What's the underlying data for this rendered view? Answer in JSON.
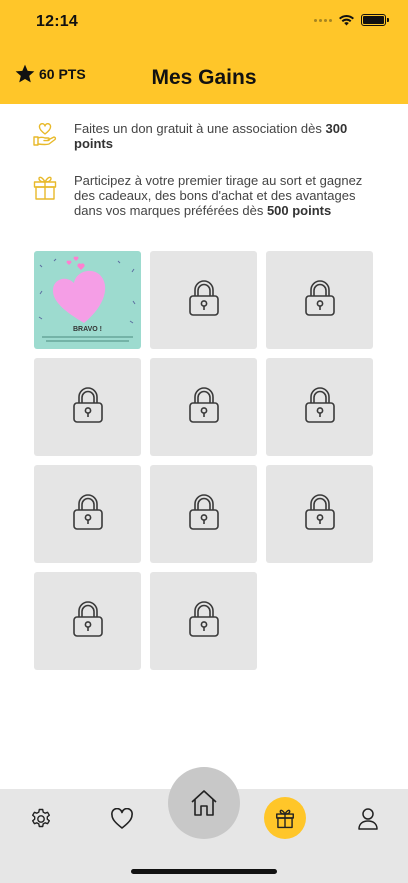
{
  "status_bar": {
    "time": "12:14"
  },
  "header": {
    "points": "60 PTS",
    "title": "Mes Gains"
  },
  "info": [
    {
      "text": "Faites un don gratuit à une association dès ",
      "bold": "300 points",
      "icon": "hand-heart-icon"
    },
    {
      "text": "Participez à votre premier tirage au sort et gagnez des cadeaux, des bons d'achat et des avantages dans vos marques préférées dès ",
      "bold": "500 points",
      "icon": "gift-icon"
    }
  ],
  "rewards": {
    "unlocked_label": "BRAVO !",
    "tiles": [
      {
        "state": "unlocked"
      },
      {
        "state": "locked"
      },
      {
        "state": "locked"
      },
      {
        "state": "locked"
      },
      {
        "state": "locked"
      },
      {
        "state": "locked"
      },
      {
        "state": "locked"
      },
      {
        "state": "locked"
      },
      {
        "state": "locked"
      },
      {
        "state": "locked"
      },
      {
        "state": "locked"
      }
    ]
  },
  "tabbar": {
    "items": [
      "settings-icon",
      "heart-icon",
      "home-icon",
      "gift-icon",
      "user-icon"
    ],
    "active": "gift-icon"
  },
  "colors": {
    "accent": "#FFC629",
    "tile": "#e5e5e5",
    "tabbar": "#e6e6e6"
  }
}
